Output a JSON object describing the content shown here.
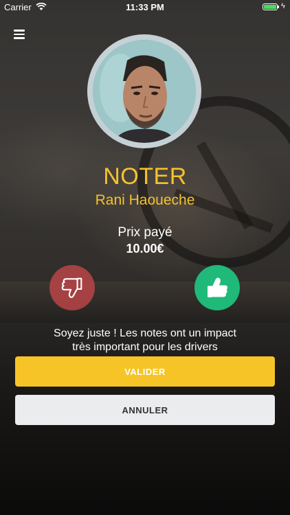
{
  "status_bar": {
    "carrier": "Carrier",
    "time": "11:33 PM",
    "wifi_icon": "wifi-icon",
    "battery_icon": "battery-icon",
    "battery_level": 1.0,
    "charging_icon": "bolt-icon"
  },
  "header": {
    "menu_icon": "hamburger-menu-icon"
  },
  "rating": {
    "title": "NOTER",
    "driver_name": "Rani Haoueche",
    "price_label": "Prix payé",
    "price_value": "10.00€",
    "thumb_down_icon": "thumbs-down-icon",
    "thumb_up_icon": "thumbs-up-icon",
    "hint_line1": "Soyez juste ! Les notes ont un impact",
    "hint_line2": "très important pour les drivers"
  },
  "actions": {
    "validate_label": "VALIDER",
    "cancel_label": "ANNULER"
  },
  "colors": {
    "accent": "#f5c22c",
    "positive": "#1fb97a",
    "negative": "#be4648",
    "cancel_bg": "#ebecee"
  }
}
